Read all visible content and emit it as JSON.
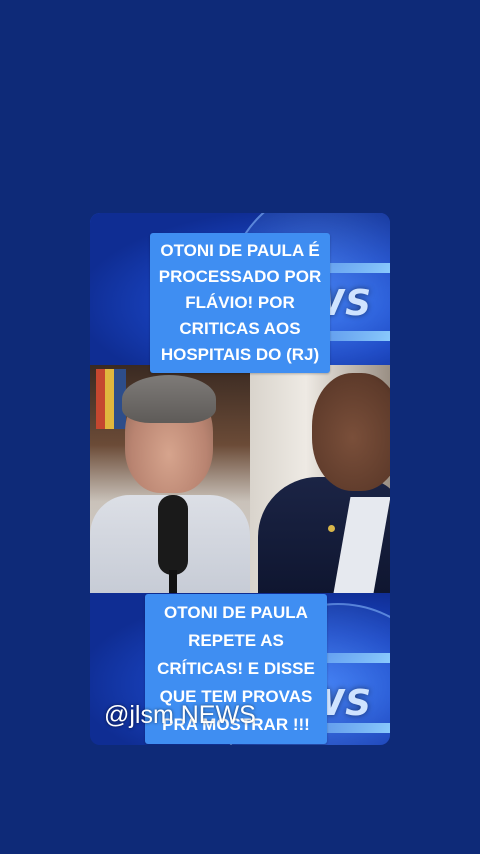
{
  "video": {
    "caption_top": "OTONI DE PAULA É PROCESSADO POR FLÁVIO! POR CRITICAS AOS HOSPITAIS DO (RJ)",
    "caption_bottom": "OTONI DE PAULA REPETE AS CRÍTICAS! E DISSE QUE TEM PROVAS PRA MOSTRAR !!!",
    "background_word": "NEWS",
    "watermark": "@jlsm NEWS"
  },
  "colors": {
    "page_background": "#0e2a78",
    "caption_background": "#3f8ef2",
    "caption_text": "#ffffff"
  }
}
